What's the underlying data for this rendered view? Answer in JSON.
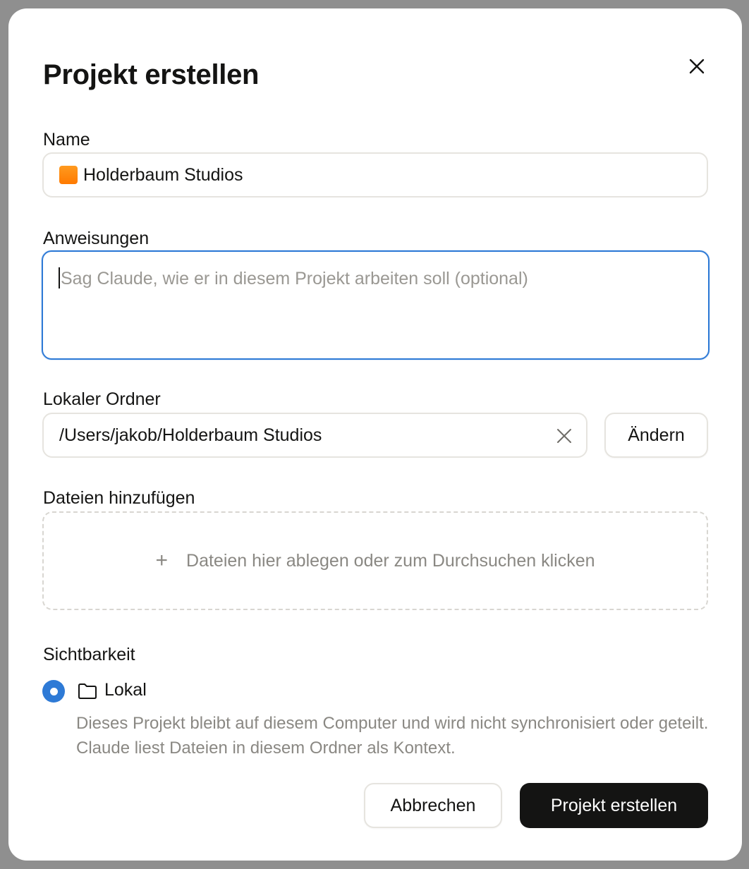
{
  "dialog": {
    "title": "Projekt erstellen",
    "close_icon": "close-icon"
  },
  "name_field": {
    "label": "Name",
    "emoji": "orange-square",
    "value": "Holderbaum Studios"
  },
  "instructions_field": {
    "label": "Anweisungen",
    "placeholder": "Sag Claude, wie er in diesem Projekt arbeiten soll (optional)",
    "value": ""
  },
  "folder_field": {
    "label": "Lokaler Ordner",
    "value": "/Users/jakob/Holderbaum Studios",
    "clear_icon": "clear-icon",
    "change_label": "Ändern"
  },
  "files": {
    "label": "Dateien hinzufügen",
    "plus_icon": "plus-icon",
    "dropzone_text": "Dateien hier ablegen oder zum Durchsuchen klicken"
  },
  "visibility": {
    "label": "Sichtbarkeit",
    "option_label": "Lokal",
    "option_icon": "folder-icon",
    "selected": true,
    "description": "Dieses Projekt bleibt auf diesem Computer und wird nicht synchronisiert oder geteilt. Claude liest Dateien in diesem Ordner als Kontext."
  },
  "actions": {
    "cancel_label": "Abbrechen",
    "submit_label": "Projekt erstellen"
  },
  "colors": {
    "accent": "#2e7ad6",
    "primary_button": "#141413",
    "muted_text": "#8a8883"
  }
}
